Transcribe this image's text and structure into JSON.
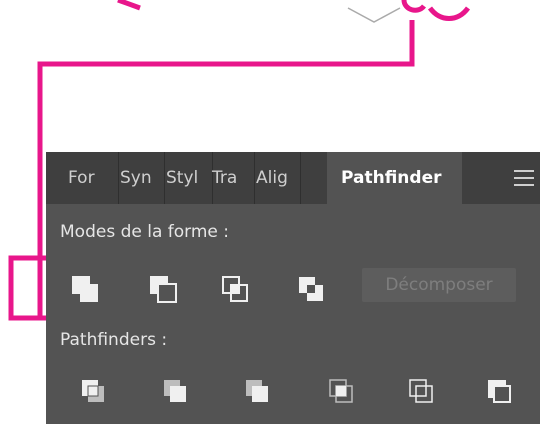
{
  "colors": {
    "highlight": "#e8168b",
    "panel_bg": "#535353",
    "tabbar_bg": "#3f3f3f",
    "text": "#e6e6e6",
    "disabled_text": "#7e7e7e"
  },
  "tabs": [
    {
      "label": "For"
    },
    {
      "label": "Syn"
    },
    {
      "label": "Styl"
    },
    {
      "label": "Tra"
    },
    {
      "label": "Alig"
    },
    {
      "label": "Pathfinder",
      "active": true
    }
  ],
  "panel_menu_icon": "hamburger-menu-icon",
  "shape_modes": {
    "title": "Modes de la forme :",
    "buttons": [
      {
        "icon": "unite-icon"
      },
      {
        "icon": "minus-front-icon"
      },
      {
        "icon": "intersect-icon"
      },
      {
        "icon": "exclude-icon"
      }
    ],
    "expand_label": "Décomposer"
  },
  "pathfinders": {
    "title": "Pathfinders :",
    "buttons": [
      {
        "icon": "divide-icon"
      },
      {
        "icon": "trim-icon"
      },
      {
        "icon": "merge-icon"
      },
      {
        "icon": "crop-icon"
      },
      {
        "icon": "outline-icon"
      },
      {
        "icon": "minus-back-icon"
      }
    ]
  }
}
